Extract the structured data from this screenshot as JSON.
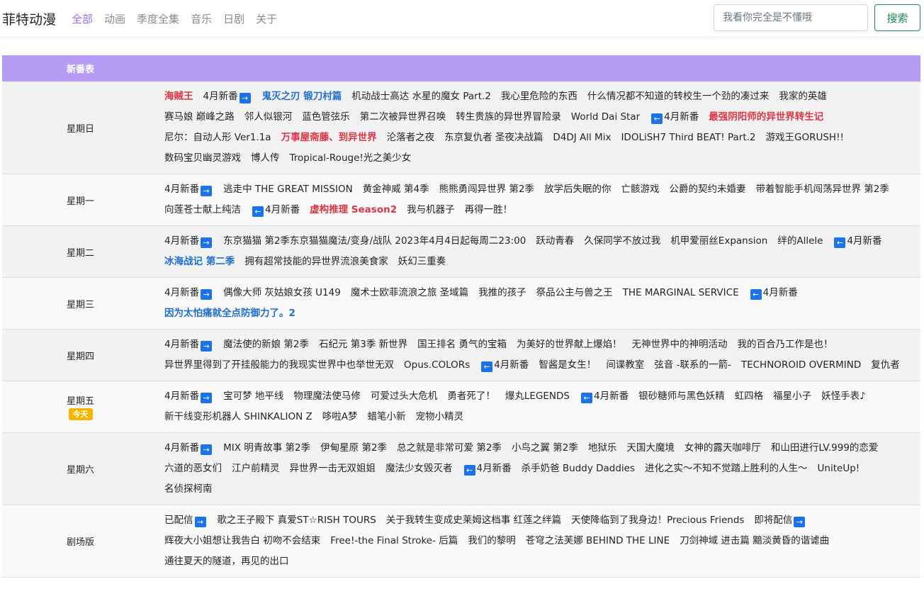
{
  "navbar": {
    "brand": "菲特动漫",
    "links": [
      "全部",
      "动画",
      "季度全集",
      "音乐",
      "日剧",
      "关于"
    ],
    "active_index": 0,
    "search_placeholder": "我看你完全是不懂哦",
    "search_button": "搜索"
  },
  "schedule": {
    "header": "新番表",
    "today_badge": "今天",
    "rows": [
      {
        "day": "星期日",
        "today": false,
        "items": [
          {
            "text": "海贼王",
            "style": "red"
          },
          {
            "text": "4月新番",
            "arrow": "right"
          },
          {
            "text": "鬼灭之刃 锻刀村篇",
            "style": "blue"
          },
          {
            "text": "机动战士高达 水星的魔女 Part.2"
          },
          {
            "text": "我心里危险的东西"
          },
          {
            "text": "什么情况都不知道的转校生一个劲的凑过来"
          },
          {
            "text": "我家的英雄"
          },
          {
            "text": "赛马娘 巅峰之路"
          },
          {
            "text": "邻人似银河"
          },
          {
            "text": "蓝色管弦乐"
          },
          {
            "text": "第二次被异世界召唤"
          },
          {
            "text": "转生贵族的异世界冒险录"
          },
          {
            "text": "World Dai Star"
          },
          {
            "text": "4月新番",
            "arrow": "left"
          },
          {
            "text": "最强阴阳师的异世界转生记",
            "style": "red"
          },
          {
            "text": "尼尔：自动人形 Ver1.1a"
          },
          {
            "text": "万事屋斋藤、到异世界",
            "style": "red"
          },
          {
            "text": "沦落者之夜"
          },
          {
            "text": "东京复仇者 圣夜决战篇"
          },
          {
            "text": "D4DJ All Mix"
          },
          {
            "text": "IDOLiSH7 Third BEAT! Part.2"
          },
          {
            "text": "游戏王GORUSH!!"
          },
          {
            "text": "数码宝贝幽灵游戏"
          },
          {
            "text": "博人传"
          },
          {
            "text": "Tropical-Rouge!光之美少女"
          }
        ]
      },
      {
        "day": "星期一",
        "today": false,
        "items": [
          {
            "text": "4月新番",
            "arrow": "right"
          },
          {
            "text": "逃走中 THE GREAT MISSION"
          },
          {
            "text": "黄金神威 第4季"
          },
          {
            "text": "熊熊勇闯异世界 第2季"
          },
          {
            "text": "放学后失眠的你"
          },
          {
            "text": "亡骸游戏"
          },
          {
            "text": "公爵的契约未婚妻"
          },
          {
            "text": "带着智能手机闯荡异世界 第2季"
          },
          {
            "text": "向莲苍士献上纯洁"
          },
          {
            "text": "4月新番",
            "arrow": "left"
          },
          {
            "text": "虚构推理 Season2",
            "style": "red"
          },
          {
            "text": "我与机器子"
          },
          {
            "text": "再得一胜！"
          }
        ]
      },
      {
        "day": "星期二",
        "today": false,
        "items": [
          {
            "text": "4月新番",
            "arrow": "right"
          },
          {
            "text": "东京猫猫 第2季东京猫猫魔法/变身/战队 2023年4月4日起每周二23:00"
          },
          {
            "text": "跃动青春"
          },
          {
            "text": "久保同学不放过我"
          },
          {
            "text": "机甲爱丽丝Expansion"
          },
          {
            "text": "绊的Allele"
          },
          {
            "text": "4月新番",
            "arrow": "left"
          },
          {
            "text": "冰海战记 第二季",
            "style": "blue"
          },
          {
            "text": "拥有超常技能的异世界流浪美食家"
          },
          {
            "text": "妖幻三重奏"
          }
        ]
      },
      {
        "day": "星期三",
        "today": false,
        "items": [
          {
            "text": "4月新番",
            "arrow": "right"
          },
          {
            "text": "偶像大师 灰姑娘女孩 U149"
          },
          {
            "text": "魔术士欧菲流浪之旅 圣域篇"
          },
          {
            "text": "我推的孩子"
          },
          {
            "text": "祭品公主与兽之王"
          },
          {
            "text": "THE MARGINAL SERVICE"
          },
          {
            "text": "4月新番",
            "arrow": "left"
          },
          {
            "text": "因为太怕痛就全点防御力了。2",
            "style": "blue"
          }
        ]
      },
      {
        "day": "星期四",
        "today": false,
        "items": [
          {
            "text": "4月新番",
            "arrow": "right"
          },
          {
            "text": "魔法使的新娘 第2季"
          },
          {
            "text": "石纪元 第3季 新世界"
          },
          {
            "text": "国王排名 勇气的宝箱"
          },
          {
            "text": "为美好的世界献上爆焰！"
          },
          {
            "text": "无神世界中的神明活动"
          },
          {
            "text": "我的百合乃工作是也！"
          },
          {
            "text": "异世界里得到了开挂般能力的我现实世界中也举世无双"
          },
          {
            "text": "Opus.COLORs"
          },
          {
            "text": "4月新番",
            "arrow": "left"
          },
          {
            "text": "智酱是女生！"
          },
          {
            "text": "间谍教室"
          },
          {
            "text": "弦音 -联系的一箭-"
          },
          {
            "text": "TECHNOROID OVERMIND"
          },
          {
            "text": "复仇者"
          }
        ]
      },
      {
        "day": "星期五",
        "today": true,
        "items": [
          {
            "text": "4月新番",
            "arrow": "right"
          },
          {
            "text": "宝可梦 地平线"
          },
          {
            "text": "物理魔法使马修"
          },
          {
            "text": "可爱过头大危机"
          },
          {
            "text": "勇者死了！"
          },
          {
            "text": "爆丸LEGENDS"
          },
          {
            "text": "4月新番",
            "arrow": "left"
          },
          {
            "text": "银砂糖师与黑色妖精"
          },
          {
            "text": "虹四格"
          },
          {
            "text": "福星小子"
          },
          {
            "text": "妖怪手表♪"
          },
          {
            "text": "新干线变形机器人 SHINKALION Z"
          },
          {
            "text": "哆啦A梦"
          },
          {
            "text": "蜡笔小新"
          },
          {
            "text": "宠物小精灵"
          }
        ]
      },
      {
        "day": "星期六",
        "today": false,
        "items": [
          {
            "text": "4月新番",
            "arrow": "right"
          },
          {
            "text": "MIX 明青故事 第2季"
          },
          {
            "text": "伊甸星原 第2季"
          },
          {
            "text": "总之就是非常可爱 第2季"
          },
          {
            "text": "小鸟之翼 第2季"
          },
          {
            "text": "地狱乐"
          },
          {
            "text": "天国大魔境"
          },
          {
            "text": "女神的露天咖啡厅"
          },
          {
            "text": "和山田进行LV.999的恋爱"
          },
          {
            "text": "六道的恶女们"
          },
          {
            "text": "江户前精灵"
          },
          {
            "text": "异世界一击无双姐姐"
          },
          {
            "text": "魔法少女毁灭者"
          },
          {
            "text": "4月新番",
            "arrow": "left"
          },
          {
            "text": "杀手奶爸 Buddy Daddies"
          },
          {
            "text": "进化之实～不知不觉踏上胜利的人生～"
          },
          {
            "text": "UniteUp!"
          },
          {
            "text": "名侦探柯南"
          }
        ]
      },
      {
        "day": "剧场版",
        "today": false,
        "items": [
          {
            "text": "已配信",
            "arrow": "right"
          },
          {
            "text": "歌之王子殿下 真爱ST☆RISH TOURS"
          },
          {
            "text": "关于我转生变成史莱姆这档事 红莲之绊篇"
          },
          {
            "text": "天使降临到了我身边！Precious Friends"
          },
          {
            "text": "即将配信",
            "arrow": "right"
          },
          {
            "text": "辉夜大小姐想让我告白 初吻不会结束"
          },
          {
            "text": "Free!-the Final Stroke- 后篇"
          },
          {
            "text": "我们的黎明"
          },
          {
            "text": "苍穹之法芙娜 BEHIND THE LINE"
          },
          {
            "text": "刀剑神域 进击篇 黯淡黄昏的谐谑曲"
          },
          {
            "text": "通往夏天的隧道，再见的出口"
          }
        ]
      }
    ]
  }
}
